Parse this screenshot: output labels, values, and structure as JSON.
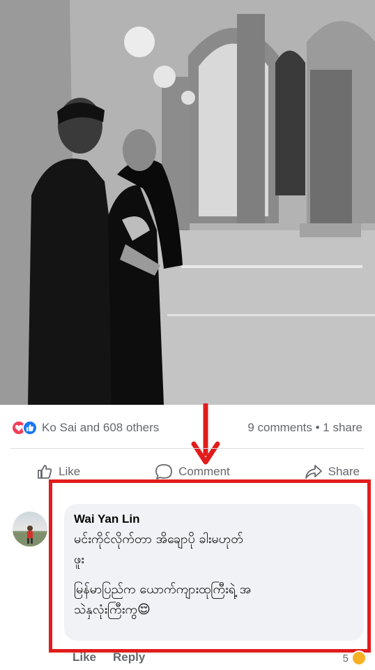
{
  "post": {
    "photo_description": "",
    "reactions_text": "Ko Sai and 608 others",
    "comments_shares_text": "9 comments • 1 share"
  },
  "actions": {
    "like": "Like",
    "comment": "Comment",
    "share": "Share"
  },
  "comment": {
    "author": "Wai Yan Lin",
    "line1": "မင်းကိုင်လိုက်တာ အိချောပို ခါးမဟုတ်",
    "line2": "ဖူး",
    "line3": "မြန်မာပြည်က ယောက်ကျားထုကြီးရဲ့ အ",
    "line4": "သဲနှလုံးကြီးကွ😌",
    "like": "Like",
    "reply": "Reply",
    "reaction_count": "5"
  },
  "colors": {
    "highlight": "#e21c1c",
    "like_blue": "#1877f2",
    "love_red": "#f33e58",
    "haha_yellow": "#f7b125"
  }
}
